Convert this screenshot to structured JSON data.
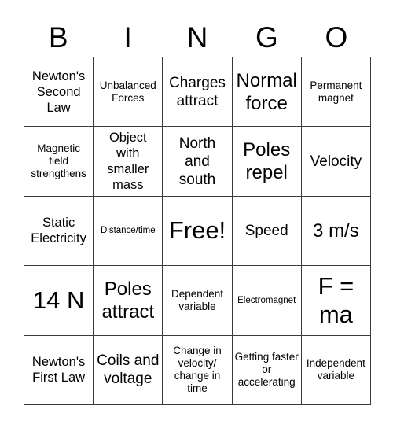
{
  "header": {
    "letters": [
      "B",
      "I",
      "N",
      "G",
      "O"
    ]
  },
  "grid": {
    "rows": 5,
    "columns": 5,
    "border_color": "#3a3a3a",
    "background_color": "#ffffff",
    "text_color": "#000000",
    "cells": [
      [
        {
          "text": "Newton's Second Law",
          "size": "m"
        },
        {
          "text": "Unbalanced Forces",
          "size": "s"
        },
        {
          "text": "Charges attract",
          "size": "l"
        },
        {
          "text": "Normal force",
          "size": "xl"
        },
        {
          "text": "Permanent magnet",
          "size": "s"
        }
      ],
      [
        {
          "text": "Magnetic field strengthens",
          "size": "s"
        },
        {
          "text": "Object with smaller mass",
          "size": "m"
        },
        {
          "text": "North and south",
          "size": "l"
        },
        {
          "text": "Poles repel",
          "size": "xl"
        },
        {
          "text": "Velocity",
          "size": "l"
        }
      ],
      [
        {
          "text": "Static Electricity",
          "size": "m"
        },
        {
          "text": "Distance/time",
          "size": "xs"
        },
        {
          "text": "Free!",
          "size": "xxl"
        },
        {
          "text": "Speed",
          "size": "l"
        },
        {
          "text": "3 m/s",
          "size": "xl"
        }
      ],
      [
        {
          "text": "14 N",
          "size": "xxl"
        },
        {
          "text": "Poles attract",
          "size": "xl"
        },
        {
          "text": "Dependent variable",
          "size": "s"
        },
        {
          "text": "Electromagnet",
          "size": "xs"
        },
        {
          "text": "F = ma",
          "size": "xxl"
        }
      ],
      [
        {
          "text": "Newton's First Law",
          "size": "m"
        },
        {
          "text": "Coils and voltage",
          "size": "l"
        },
        {
          "text": "Change in velocity/ change in time",
          "size": "s"
        },
        {
          "text": "Getting faster or accelerating",
          "size": "s"
        },
        {
          "text": "Independent variable",
          "size": "s"
        }
      ]
    ]
  }
}
